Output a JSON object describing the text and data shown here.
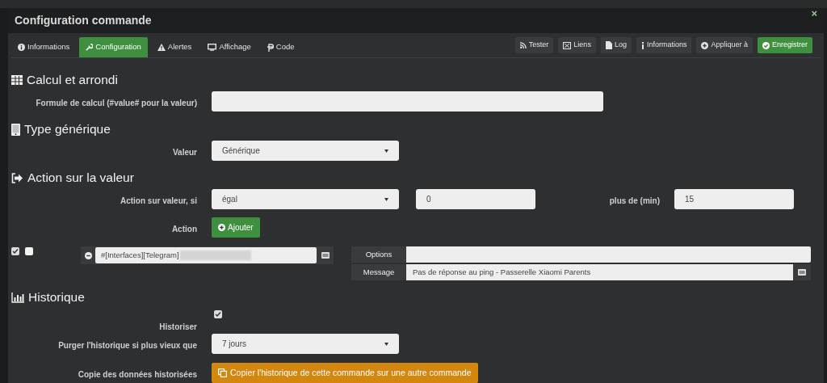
{
  "window": {
    "title": "Configuration commande",
    "close": "×"
  },
  "tabs": [
    {
      "label": "Informations",
      "selected": false
    },
    {
      "label": "Configuration",
      "selected": true
    },
    {
      "label": "Alertes",
      "selected": false
    },
    {
      "label": "Affichage",
      "selected": false
    },
    {
      "label": "Code",
      "selected": false
    }
  ],
  "toolbar_buttons": [
    {
      "label": "Tester",
      "kind": "default"
    },
    {
      "label": "Liens",
      "kind": "default"
    },
    {
      "label": "Log",
      "kind": "default"
    },
    {
      "label": "Informations",
      "kind": "default"
    },
    {
      "label": "Appliquer à",
      "kind": "default"
    },
    {
      "label": "Enregistrer",
      "kind": "success"
    }
  ],
  "calcul": {
    "heading": "Calcul et arrondi",
    "formula_label": "Formule de calcul (#value# pour la valeur)"
  },
  "generic_type": {
    "heading": "Type générique",
    "label": "Valeur",
    "value": "Générique"
  },
  "value_action": {
    "heading": "Action sur la valeur",
    "condition_label": "Action sur valeur, si",
    "operator": "égal",
    "operand": "0",
    "duration_label": "plus de (min)",
    "duration": "15",
    "action_label": "Action",
    "add_button": "Ajouter",
    "actions": [
      {
        "enabled": true,
        "background": false,
        "command": "#[Interfaces][Telegram]",
        "redacted": true,
        "options_label": "Options",
        "message_label": "Message",
        "message": "Pas de réponse au ping - Passerelle Xiaomi Parents"
      }
    ]
  },
  "history": {
    "heading": "Historique",
    "historize_label": "Historiser",
    "historize": true,
    "purge_label": "Purger l'historique si plus vieux que",
    "purge": "7 jours",
    "copy_label": "Copie des données historisées",
    "copy_button": "Copier l'historique de cette commande sur une autre commande"
  }
}
